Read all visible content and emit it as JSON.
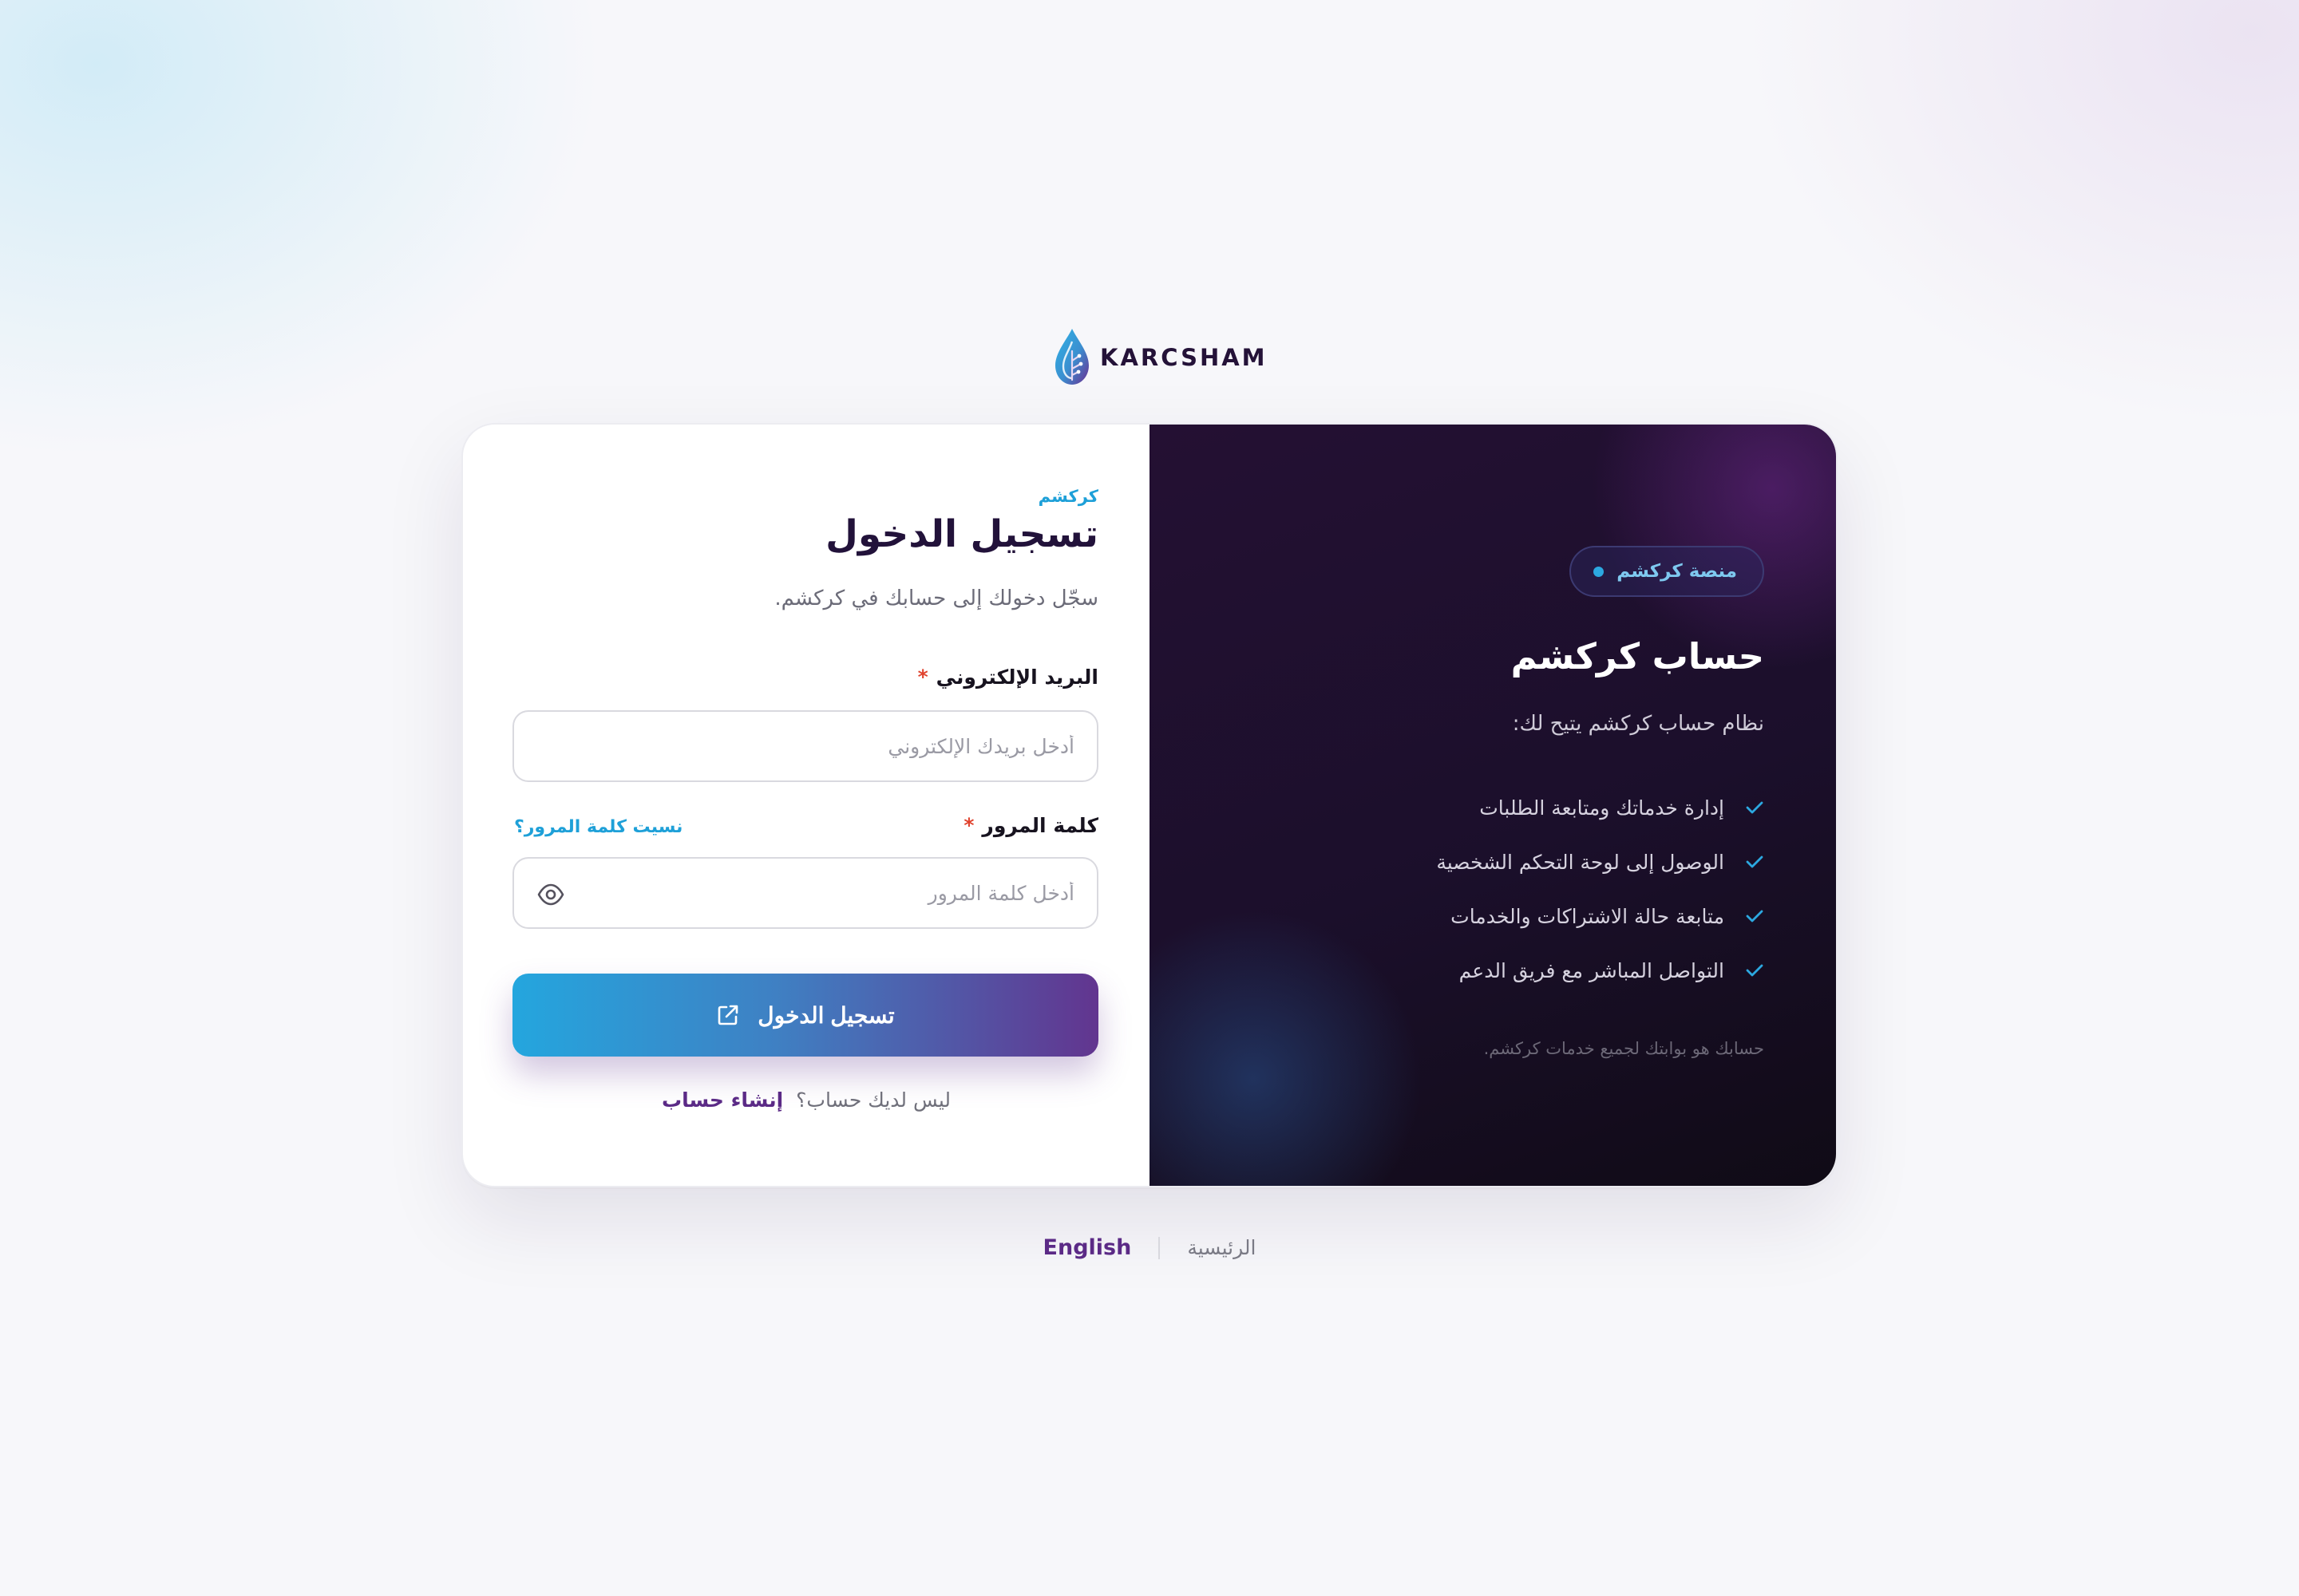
{
  "brand": {
    "name": "KARCSHAM"
  },
  "login": {
    "eyebrow": "كركشم",
    "title": "تسجيل الدخول",
    "subtitle": "سجّل دخولك إلى حسابك في كركشم.",
    "email": {
      "label": "البريد الإلكتروني",
      "required_mark": "*",
      "placeholder": "أدخل بريدك الإلكتروني",
      "value": ""
    },
    "password": {
      "label": "كلمة المرور",
      "required_mark": "*",
      "placeholder": "أدخل كلمة المرور",
      "value": "",
      "forgot_label": "نسيت كلمة المرور؟"
    },
    "submit_label": "تسجيل الدخول",
    "signup_prompt": "ليس لديك حساب؟",
    "signup_link": "إنشاء حساب"
  },
  "promo": {
    "badge": "منصة كركشم",
    "title": "حساب كركشم",
    "intro": "نظام حساب كركشم يتيح لك:",
    "features": [
      "إدارة خدماتك ومتابعة الطلبات",
      "الوصول إلى لوحة التحكم الشخصية",
      "متابعة حالة الاشتراكات والخدمات",
      "التواصل المباشر مع فريق الدعم"
    ],
    "note": "حسابك هو بوابتك لجميع خدمات كركشم."
  },
  "footer": {
    "home": "الرئيسية",
    "language": "English"
  },
  "colors": {
    "accent_blue": "#1ea0d8",
    "accent_purple": "#5b2a86",
    "required": "#e0432e",
    "dark_panel": "#1b0f2b"
  },
  "icons": {
    "logo": "droplet-logo-icon",
    "eye": "eye-icon",
    "submit": "external-link-icon",
    "check": "check-icon",
    "badge_dot": "dot-icon"
  }
}
